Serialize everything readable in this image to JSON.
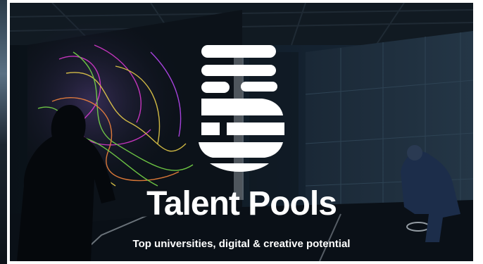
{
  "hero": {
    "logo_numeral": "5",
    "title": "Talent Pools",
    "subtitle": "Top universities, digital & creative potential"
  },
  "colors": {
    "text": "#ffffff",
    "background": "#0f1a24",
    "accent_magenta": "#e23bd6",
    "accent_yellow": "#f2d64b",
    "accent_green": "#7de24a"
  }
}
